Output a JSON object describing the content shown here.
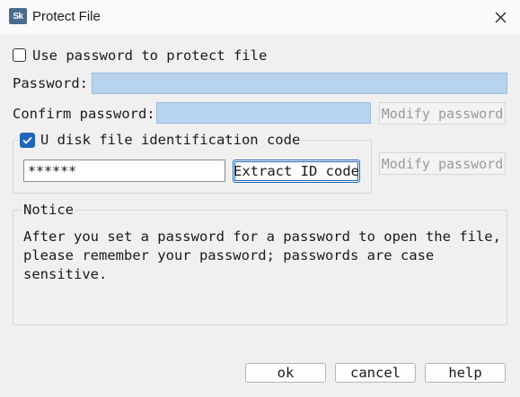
{
  "window": {
    "title": "Protect File",
    "app_icon_text": "Sk"
  },
  "password_section": {
    "use_password_label": "Use password to protect file",
    "use_password_checked": false,
    "password_label": "Password:",
    "password_value": "",
    "confirm_label": "Confirm password:",
    "confirm_value": "",
    "modify_password_label": "Modify password"
  },
  "udisk_section": {
    "group_label": "U disk file identification code",
    "group_checked": true,
    "id_code_value": "******",
    "extract_button_label": "Extract ID code",
    "modify_password_label": "Modify password"
  },
  "notice": {
    "group_label": "Notice",
    "lines": [
      "After you set a password for a password to open the file,",
      "please remember your password; passwords are case",
      "sensitive."
    ]
  },
  "footer": {
    "ok_label": "ok",
    "cancel_label": "cancel",
    "help_label": "help"
  },
  "colors": {
    "accent": "#1f67b6",
    "field_highlight": "#b8d3ee",
    "background": "#f0f0f0"
  }
}
